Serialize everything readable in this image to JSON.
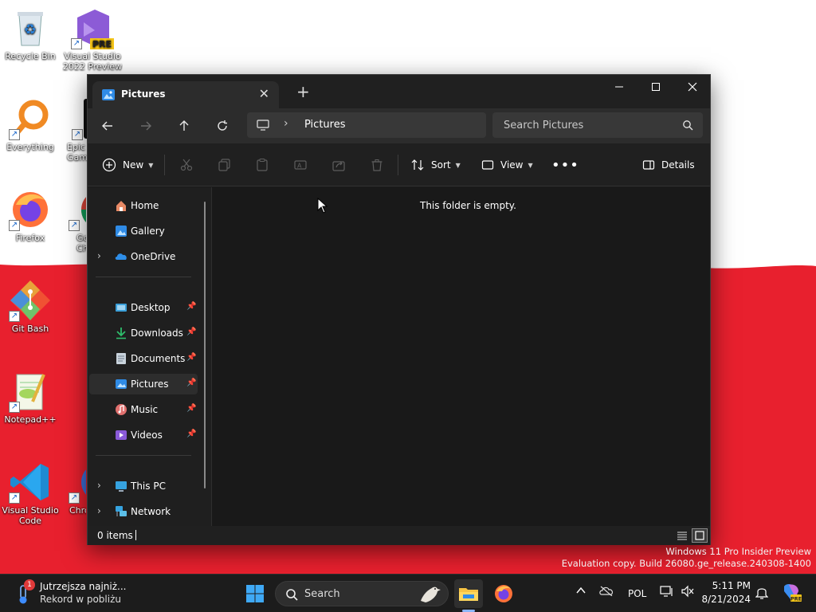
{
  "desktop": {
    "icons": [
      {
        "label": "Recycle Bin"
      },
      {
        "label": "Visual Studio 2022 Preview"
      },
      {
        "label": "Everything"
      },
      {
        "label": "Epic Games Launcher"
      },
      {
        "label": "Firefox"
      },
      {
        "label": "Google Chrome"
      },
      {
        "label": "Git Bash"
      },
      {
        "label": "Notepad++"
      },
      {
        "label": "Visual Studio Code"
      },
      {
        "label": "Chrome"
      }
    ],
    "watermark": {
      "line1": "Windows 11 Pro Insider Preview",
      "line2": "Evaluation copy. Build 26080.ge_release.240308-1400"
    }
  },
  "window": {
    "tab_title": "Pictures",
    "breadcrumb": [
      "Pictures"
    ],
    "search_placeholder": "Search Pictures",
    "toolbar": {
      "new_label": "New",
      "sort_label": "Sort",
      "view_label": "View",
      "details_label": "Details"
    },
    "sidebar": {
      "items": [
        {
          "label": "Home",
          "icon": "home-icon"
        },
        {
          "label": "Gallery",
          "icon": "gallery-icon"
        },
        {
          "label": "OneDrive",
          "icon": "onedrive-icon"
        },
        {
          "label": "Desktop",
          "icon": "desktop-folder-icon"
        },
        {
          "label": "Downloads",
          "icon": "downloads-icon"
        },
        {
          "label": "Documents",
          "icon": "documents-icon"
        },
        {
          "label": "Pictures",
          "icon": "pictures-icon"
        },
        {
          "label": "Music",
          "icon": "music-icon"
        },
        {
          "label": "Videos",
          "icon": "videos-icon"
        },
        {
          "label": "This PC",
          "icon": "this-pc-icon"
        },
        {
          "label": "Network",
          "icon": "network-icon"
        }
      ]
    },
    "content": {
      "empty_message": "This folder is empty."
    },
    "status": {
      "item_count": "0 items"
    }
  },
  "taskbar": {
    "weather": {
      "title": "Jutrzejsza najniż...",
      "subtitle": "Rekord w pobliżu",
      "badge": "1"
    },
    "search_label": "Search",
    "language": "POL",
    "time": "5:11 PM",
    "date": "8/21/2024"
  },
  "colors": {
    "wallpaper_red": "#e8202e",
    "window_bg": "#191919",
    "accent_blue": "#4cc2ff"
  }
}
